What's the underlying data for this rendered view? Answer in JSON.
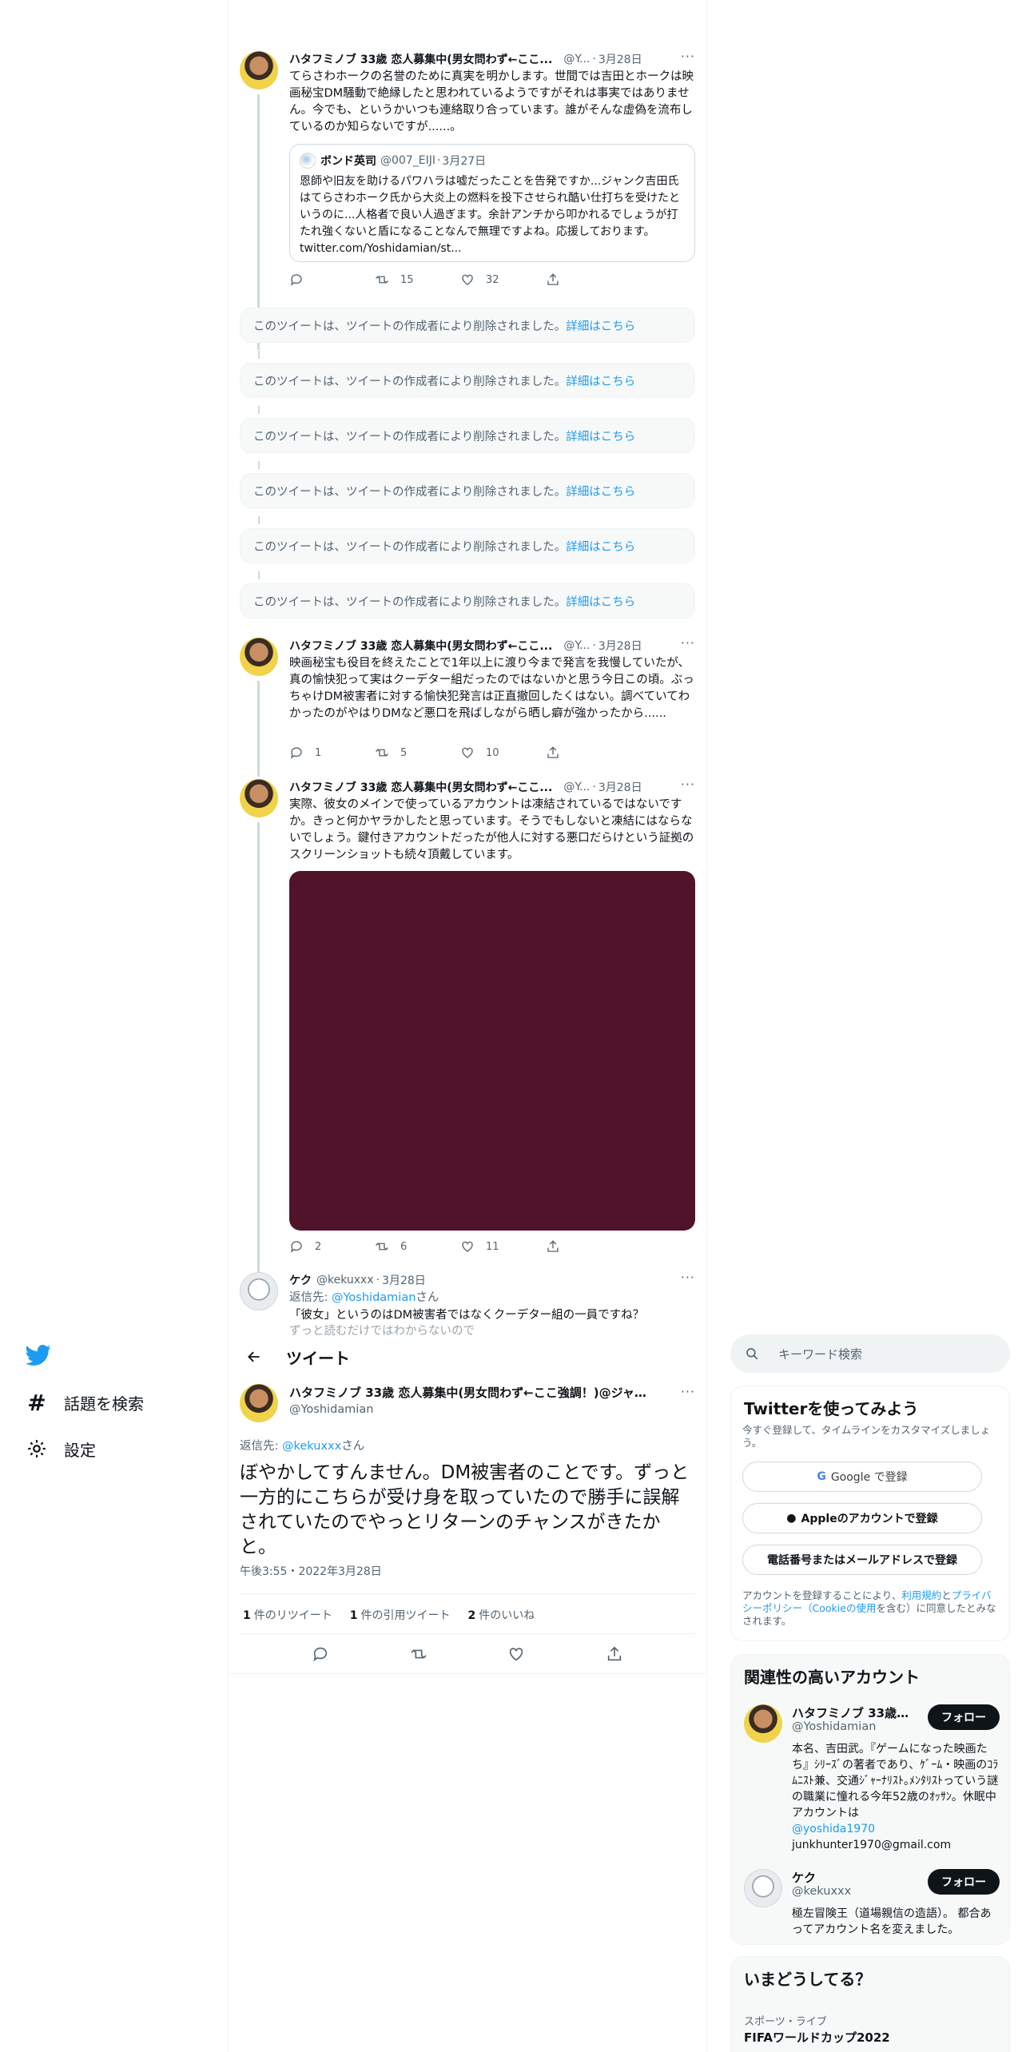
{
  "thread": {
    "tweet1": {
      "name": "ハタフミノブ 33歳 恋人募集中(男女問わず←ここ...",
      "handle": "@Y...",
      "date": "3月28日",
      "text": "てらさわホークの名誉のために真実を明かします。世間では吉田とホークは映画秘宝DM騒動で絶縁したと思われているようですがそれは事実ではありません。今でも、というかいつも連絡取り合っています。誰がそんな虚偽を流布しているのか知らないですが......。",
      "quote": {
        "name": "ボンド英司",
        "handle": "@007_EIJI",
        "date": "3月27日",
        "text": "恩師や旧友を助けるパワハラは嘘だったことを告発ですか...ジャンク吉田氏はてらさわホーク氏から大炎上の燃料を投下させられ酷い仕打ちを受けたというのに...人格者で良い人過ぎます。余計アンチから叩かれるでしょうが打たれ強くないと盾になることなんで無理ですよね。応援しております。 twitter.com/Yoshidamian/st..."
      },
      "replies": "",
      "retweets": "15",
      "likes": "32"
    },
    "deleted_notices": [
      {
        "text": "このツイートは、ツイートの作成者により削除されました。",
        "link": "詳細はこちら"
      },
      {
        "text": "このツイートは、ツイートの作成者により削除されました。",
        "link": "詳細はこちら"
      },
      {
        "text": "このツイートは、ツイートの作成者により削除されました。",
        "link": "詳細はこちら"
      },
      {
        "text": "このツイートは、ツイートの作成者により削除されました。",
        "link": "詳細はこちら"
      },
      {
        "text": "このツイートは、ツイートの作成者により削除されました。",
        "link": "詳細はこちら"
      },
      {
        "text": "このツイートは、ツイートの作成者により削除されました。",
        "link": "詳細はこちら"
      }
    ],
    "tweet2": {
      "name": "ハタフミノブ 33歳 恋人募集中(男女問わず←ここ...",
      "handle": "@Y...",
      "date": "3月28日",
      "text": "映画秘宝も役目を終えたことで1年以上に渡り今まで発言を我慢していたが、真の愉快犯って実はクーデター組だったのではないかと思う今日この頃。ぶっちゃけDM被害者に対する愉快犯発言は正直撤回したくはない。調べていてわかったのがやはりDMなど悪口を飛ばしながら晒し癖が強かったから......",
      "replies": "1",
      "retweets": "5",
      "likes": "10"
    },
    "tweet3": {
      "name": "ハタフミノブ 33歳 恋人募集中(男女問わず←ここ...",
      "handle": "@Y...",
      "date": "3月28日",
      "text": "実際、彼女のメインで使っているアカウントは凍結されているではないですか。きっと何かヤラかしたと思っています。そうでもしないと凍結にはならないでしょう。鍵付きアカウントだったが他人に対する悪口だらけという証拠のスクリーンショットも続々頂戴しています。",
      "replies": "2",
      "retweets": "6",
      "likes": "11"
    },
    "tweet4": {
      "name": "ケク",
      "handle": "@kekuxxx",
      "date": "3月28日",
      "reply_prefix": "返信先:",
      "reply_to": "@Yoshidamian",
      "reply_suffix": "さん",
      "text": "「彼女」というのはDM被害者ではなくクーデター組の一員ですね？",
      "text_cut": "ずっと読むだけではわからないので"
    }
  },
  "nav": {
    "explore_label": "話題を検索",
    "settings_label": "設定"
  },
  "header": {
    "title": "ツイート"
  },
  "main_tweet": {
    "name": "ハタフミノブ 33歳 恋人募集中(男女問わず←ここ強調！)@ジャン...",
    "handle": "@Yoshidamian",
    "reply_prefix": "返信先:",
    "reply_to": "@kekuxxx",
    "reply_suffix": "さん",
    "text": "ぼやかしてすんません。DM被害者のことです。ずっと一方的にこちらが受け身を取っていたので勝手に誤解されていたのでやっとリターンのチャンスがきたかと。",
    "time": "午後3:55・2022年3月28日",
    "stats": {
      "retweets_count": "1",
      "retweets_label": "件のリツイート",
      "quotes_count": "1",
      "quotes_label": "件の引用ツイート",
      "likes_count": "2",
      "likes_label": "件のいいね"
    }
  },
  "sidebar": {
    "search_placeholder": "キーワード検索",
    "signup": {
      "title": "Twitterを使ってみよう",
      "subtitle": "今すぐ登録して、タイムラインをカスタマイズしましょう。",
      "google": "Google で登録",
      "apple": "Appleのアカウントで登録",
      "phone": "電話番号またはメールアドレスで登録",
      "terms_prefix": "アカウントを登録することにより、",
      "terms_link": "利用規約",
      "terms_and": "と",
      "privacy_link": "プライバシーポリシー",
      "cookie_open": "（",
      "cookie_link": "Cookieの使用",
      "terms_suffix": "を含む）に同意したとみなされます。"
    },
    "related": {
      "title": "関連性の高いアカウント",
      "accounts": [
        {
          "name": "ハタフミノブ 33歳 ...",
          "handle": "@Yoshidamian",
          "follow": "フォロー",
          "bio": "本名、吉田武。『ゲームになった映画たち』ｼﾘｰｽﾞの著者であり、ｹﾞｰﾑ・映画のｺﾗﾑﾆｽﾄ兼、交通ｼﾞｬｰﾅﾘｽﾄ｡ﾒﾝﾀﾘｽﾄっていう謎の職業に憧れる今年52歳のｵｯｻﾝ。休眠中アカウントは",
          "bio_link": "@yoshida1970",
          "bio_email": "junkhunter1970@gmail.com"
        },
        {
          "name": "ケク",
          "handle": "@kekuxxx",
          "follow": "フォロー",
          "bio": "極左冒険王（道場親信の造語）。 都合あってアカウント名を変えました。"
        }
      ]
    },
    "trends": {
      "title": "いまどうしてる？",
      "items": [
        {
          "meta": "スポーツ・ライブ",
          "name": "FIFAワールドカップ2022"
        }
      ]
    }
  },
  "colors": {
    "accent": "#1d9bf0",
    "media": "#511329",
    "text": "#0f1419",
    "muted": "#536471"
  }
}
